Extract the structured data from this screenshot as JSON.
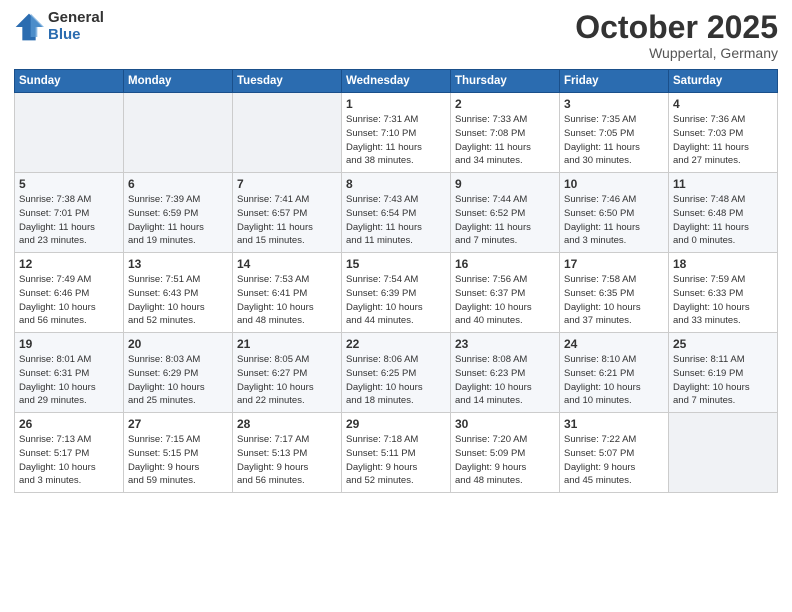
{
  "logo": {
    "general": "General",
    "blue": "Blue"
  },
  "header": {
    "month": "October 2025",
    "location": "Wuppertal, Germany"
  },
  "weekdays": [
    "Sunday",
    "Monday",
    "Tuesday",
    "Wednesday",
    "Thursday",
    "Friday",
    "Saturday"
  ],
  "weeks": [
    [
      {
        "num": "",
        "info": ""
      },
      {
        "num": "",
        "info": ""
      },
      {
        "num": "",
        "info": ""
      },
      {
        "num": "1",
        "info": "Sunrise: 7:31 AM\nSunset: 7:10 PM\nDaylight: 11 hours\nand 38 minutes."
      },
      {
        "num": "2",
        "info": "Sunrise: 7:33 AM\nSunset: 7:08 PM\nDaylight: 11 hours\nand 34 minutes."
      },
      {
        "num": "3",
        "info": "Sunrise: 7:35 AM\nSunset: 7:05 PM\nDaylight: 11 hours\nand 30 minutes."
      },
      {
        "num": "4",
        "info": "Sunrise: 7:36 AM\nSunset: 7:03 PM\nDaylight: 11 hours\nand 27 minutes."
      }
    ],
    [
      {
        "num": "5",
        "info": "Sunrise: 7:38 AM\nSunset: 7:01 PM\nDaylight: 11 hours\nand 23 minutes."
      },
      {
        "num": "6",
        "info": "Sunrise: 7:39 AM\nSunset: 6:59 PM\nDaylight: 11 hours\nand 19 minutes."
      },
      {
        "num": "7",
        "info": "Sunrise: 7:41 AM\nSunset: 6:57 PM\nDaylight: 11 hours\nand 15 minutes."
      },
      {
        "num": "8",
        "info": "Sunrise: 7:43 AM\nSunset: 6:54 PM\nDaylight: 11 hours\nand 11 minutes."
      },
      {
        "num": "9",
        "info": "Sunrise: 7:44 AM\nSunset: 6:52 PM\nDaylight: 11 hours\nand 7 minutes."
      },
      {
        "num": "10",
        "info": "Sunrise: 7:46 AM\nSunset: 6:50 PM\nDaylight: 11 hours\nand 3 minutes."
      },
      {
        "num": "11",
        "info": "Sunrise: 7:48 AM\nSunset: 6:48 PM\nDaylight: 11 hours\nand 0 minutes."
      }
    ],
    [
      {
        "num": "12",
        "info": "Sunrise: 7:49 AM\nSunset: 6:46 PM\nDaylight: 10 hours\nand 56 minutes."
      },
      {
        "num": "13",
        "info": "Sunrise: 7:51 AM\nSunset: 6:43 PM\nDaylight: 10 hours\nand 52 minutes."
      },
      {
        "num": "14",
        "info": "Sunrise: 7:53 AM\nSunset: 6:41 PM\nDaylight: 10 hours\nand 48 minutes."
      },
      {
        "num": "15",
        "info": "Sunrise: 7:54 AM\nSunset: 6:39 PM\nDaylight: 10 hours\nand 44 minutes."
      },
      {
        "num": "16",
        "info": "Sunrise: 7:56 AM\nSunset: 6:37 PM\nDaylight: 10 hours\nand 40 minutes."
      },
      {
        "num": "17",
        "info": "Sunrise: 7:58 AM\nSunset: 6:35 PM\nDaylight: 10 hours\nand 37 minutes."
      },
      {
        "num": "18",
        "info": "Sunrise: 7:59 AM\nSunset: 6:33 PM\nDaylight: 10 hours\nand 33 minutes."
      }
    ],
    [
      {
        "num": "19",
        "info": "Sunrise: 8:01 AM\nSunset: 6:31 PM\nDaylight: 10 hours\nand 29 minutes."
      },
      {
        "num": "20",
        "info": "Sunrise: 8:03 AM\nSunset: 6:29 PM\nDaylight: 10 hours\nand 25 minutes."
      },
      {
        "num": "21",
        "info": "Sunrise: 8:05 AM\nSunset: 6:27 PM\nDaylight: 10 hours\nand 22 minutes."
      },
      {
        "num": "22",
        "info": "Sunrise: 8:06 AM\nSunset: 6:25 PM\nDaylight: 10 hours\nand 18 minutes."
      },
      {
        "num": "23",
        "info": "Sunrise: 8:08 AM\nSunset: 6:23 PM\nDaylight: 10 hours\nand 14 minutes."
      },
      {
        "num": "24",
        "info": "Sunrise: 8:10 AM\nSunset: 6:21 PM\nDaylight: 10 hours\nand 10 minutes."
      },
      {
        "num": "25",
        "info": "Sunrise: 8:11 AM\nSunset: 6:19 PM\nDaylight: 10 hours\nand 7 minutes."
      }
    ],
    [
      {
        "num": "26",
        "info": "Sunrise: 7:13 AM\nSunset: 5:17 PM\nDaylight: 10 hours\nand 3 minutes."
      },
      {
        "num": "27",
        "info": "Sunrise: 7:15 AM\nSunset: 5:15 PM\nDaylight: 9 hours\nand 59 minutes."
      },
      {
        "num": "28",
        "info": "Sunrise: 7:17 AM\nSunset: 5:13 PM\nDaylight: 9 hours\nand 56 minutes."
      },
      {
        "num": "29",
        "info": "Sunrise: 7:18 AM\nSunset: 5:11 PM\nDaylight: 9 hours\nand 52 minutes."
      },
      {
        "num": "30",
        "info": "Sunrise: 7:20 AM\nSunset: 5:09 PM\nDaylight: 9 hours\nand 48 minutes."
      },
      {
        "num": "31",
        "info": "Sunrise: 7:22 AM\nSunset: 5:07 PM\nDaylight: 9 hours\nand 45 minutes."
      },
      {
        "num": "",
        "info": ""
      }
    ]
  ]
}
